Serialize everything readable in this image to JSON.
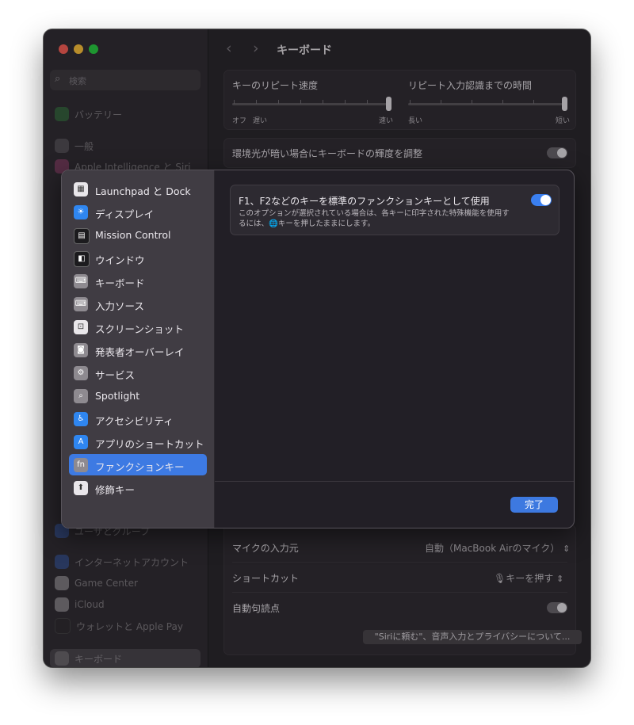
{
  "window": {
    "title": "キーボード",
    "traffic_light_colors": [
      "#f25d55",
      "#f6bd3a",
      "#29c940"
    ]
  },
  "sidebar": {
    "search_placeholder": "検索",
    "items": [
      {
        "label": "バッテリー",
        "icon": "battery-icon",
        "color": "#3a9b4a"
      },
      {
        "label": "一般",
        "icon": "gear-icon",
        "color": "#76727a"
      },
      {
        "label": "Apple Intelligence と Siri",
        "icon": "siri-icon",
        "color": "#c04c8a"
      },
      {
        "label": "ユーザとグループ",
        "icon": "users-icon",
        "color": "#3d6ed8"
      },
      {
        "label": "インターネットアカウント",
        "icon": "at-icon",
        "color": "#3d6ed8"
      },
      {
        "label": "Game Center",
        "icon": "game-center-icon",
        "color": "#d8d4da"
      },
      {
        "label": "iCloud",
        "icon": "cloud-icon",
        "color": "#d8d4da"
      },
      {
        "label": "ウォレットと Apple Pay",
        "icon": "wallet-icon",
        "color": "#2e2a2f"
      },
      {
        "label": "キーボード",
        "icon": "keyboard-icon",
        "color": "#8e8a90"
      }
    ]
  },
  "settings": {
    "repeat_rate_label": "キーのリピート速度",
    "repeat_rate_min": "オフ",
    "repeat_rate_slow": "遅い",
    "repeat_rate_fast": "速い",
    "repeat_delay_label": "リピート入力認識までの時間",
    "repeat_delay_long": "長い",
    "repeat_delay_short": "短い",
    "brightness_label": "環境光が暗い場合にキーボードの輝度を調整",
    "mic_label": "マイクの入力元",
    "mic_value": "自動（MacBook Airのマイク）",
    "shortcut_label": "ショートカット",
    "shortcut_value": "キーを押す",
    "punct_label": "自動句読点",
    "privacy_button": "\"Siriに頼む\"、音声入力とプライバシーについて..."
  },
  "sheet": {
    "nav": [
      {
        "label": "Launchpad と Dock",
        "icon": "launchpad-icon",
        "color": "#e9e6ea"
      },
      {
        "label": "ディスプレイ",
        "icon": "display-icon",
        "color": "#2f86f0"
      },
      {
        "label": "Mission Control",
        "icon": "mission-control-icon",
        "color": "#1c1b1e"
      },
      {
        "label": "ウインドウ",
        "icon": "window-icon",
        "color": "#1c1b1e"
      },
      {
        "label": "キーボード",
        "icon": "keyboard-icon",
        "color": "#8e8a90"
      },
      {
        "label": "入力ソース",
        "icon": "input-sources-icon",
        "color": "#8e8a90"
      },
      {
        "label": "スクリーンショット",
        "icon": "screenshot-icon",
        "color": "#e9e6ea"
      },
      {
        "label": "発表者オーバーレイ",
        "icon": "presenter-overlay-icon",
        "color": "#8e8a90"
      },
      {
        "label": "サービス",
        "icon": "services-icon",
        "color": "#8e8a90"
      },
      {
        "label": "Spotlight",
        "icon": "spotlight-icon",
        "color": "#8e8a90"
      },
      {
        "label": "アクセシビリティ",
        "icon": "accessibility-icon",
        "color": "#2f86f0"
      },
      {
        "label": "アプリのショートカット",
        "icon": "app-shortcuts-icon",
        "color": "#2f86f0"
      },
      {
        "label": "ファンクションキー",
        "icon": "fn-icon",
        "color": "#8e8a90"
      },
      {
        "label": "修飾キー",
        "icon": "modifier-keys-icon",
        "color": "#e9e6ea"
      }
    ],
    "selected_index": 12,
    "fn_title": "F1、F2などのキーを標準のファンクションキーとして使用",
    "fn_desc": "このオプションが選択されている場合は、各キーに印字された特殊機能を使用するには、🌐キーを押したままにします。",
    "fn_enabled": true,
    "done_label": "完了",
    "accent": "#3d7ae3"
  }
}
